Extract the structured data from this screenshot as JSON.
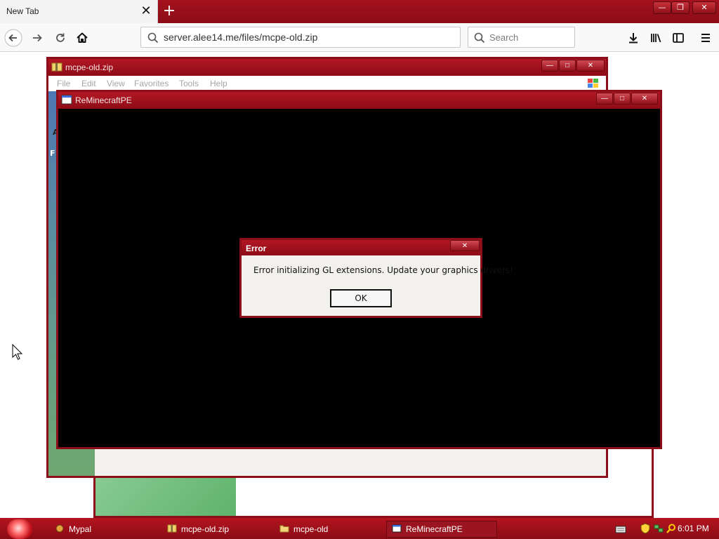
{
  "browser": {
    "tab_title": "New Tab",
    "url": "server.alee14.me/files/mcpe-old.zip",
    "search_placeholder": "Search"
  },
  "explorer": {
    "title": "mcpe-old.zip",
    "menu": [
      "File",
      "Edit",
      "View",
      "Favorites",
      "Tools",
      "Help"
    ],
    "address_char": "A",
    "folders_char": "F"
  },
  "mcpe_window": {
    "title": "ReMinecraftPE"
  },
  "error_dialog": {
    "title": "Error",
    "message": "Error initializing GL extensions. Update your graphics drivers!",
    "ok_label": "OK"
  },
  "taskbar": {
    "items": [
      "Mypal",
      "mcpe-old.zip",
      "mcpe-old",
      "ReMinecraftPE"
    ],
    "clock": "6:01 PM"
  },
  "colors": {
    "theme_red": "#8c0e18",
    "title_red": "#b11723"
  },
  "icons": [
    "back-arrow-icon",
    "forward-arrow-icon",
    "reload-icon",
    "home-icon",
    "download-icon",
    "library-icon",
    "sidebar-icon",
    "menu-icon",
    "search-icon",
    "close-icon",
    "plus-icon"
  ]
}
